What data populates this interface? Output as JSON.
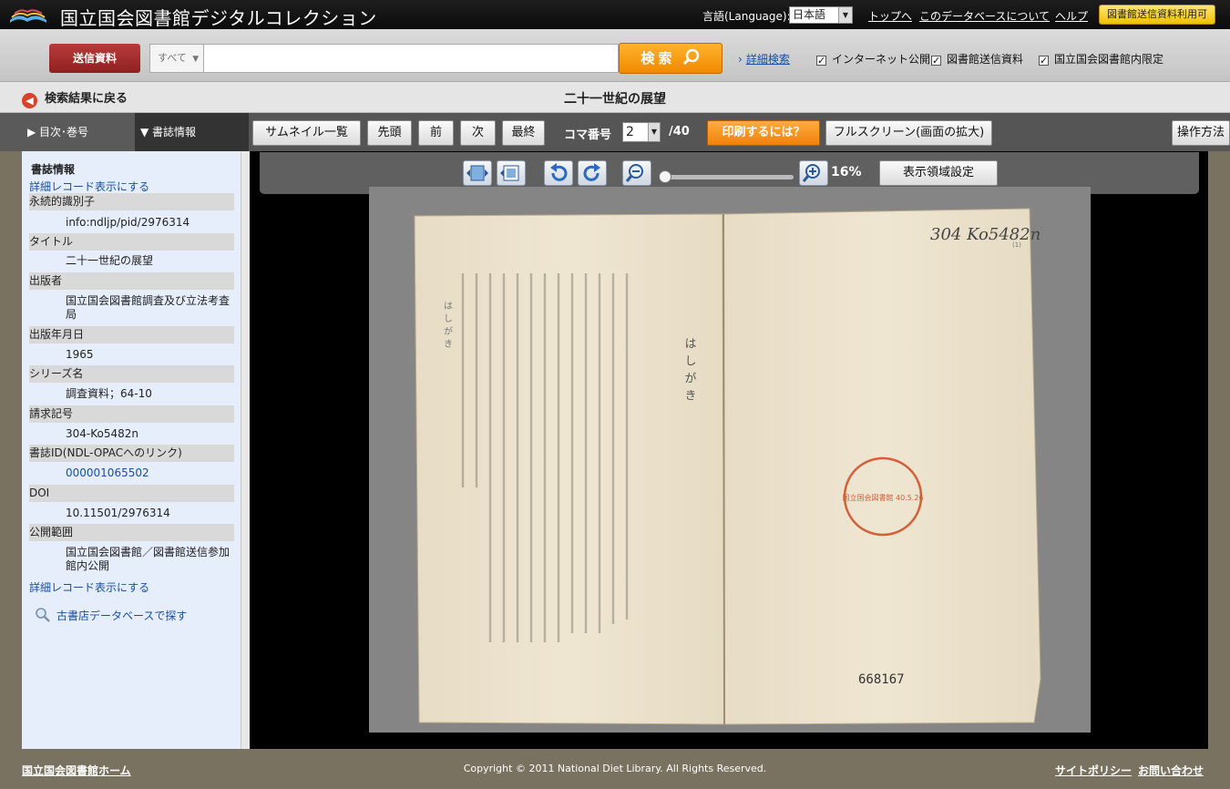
{
  "header": {
    "site_title": "国立国会図書館デジタルコレクション",
    "language_label": "言語(Language):",
    "language_value": "日本語",
    "links": [
      "トップへ",
      "このデータベースについて",
      "ヘルプ"
    ],
    "transmission_button": "図書館送信資料利用可"
  },
  "search": {
    "type_button": "送信資料",
    "scope": "すべて",
    "query": "",
    "search_button": "検索",
    "advanced_link": "詳細検索",
    "filters": [
      {
        "label": "インターネット公開",
        "checked": true
      },
      {
        "label": "図書館送信資料",
        "checked": true
      },
      {
        "label": "国立国会図書館内限定",
        "checked": true
      }
    ]
  },
  "titlebar": {
    "back_label": "検索結果に戻る",
    "title": "二十一世紀の展望"
  },
  "toolbar": {
    "tab_toc": "▶ 目次･巻号",
    "tab_biblio": "▼ 書誌情報",
    "thumbnails": "サムネイル一覧",
    "first": "先頭",
    "prev": "前",
    "next": "次",
    "last": "最終",
    "frame_label": "コマ番号",
    "frame_value": "2",
    "frame_total": "/40",
    "print": "印刷するには？",
    "fullscreen": "フルスクリーン(画面の拡大)",
    "howto": "操作方法"
  },
  "viewer": {
    "zoom_percent": "16%",
    "zoom_fraction": 0.02,
    "display_area_button": "表示領域設定"
  },
  "sidebar": {
    "heading": "書誌情報",
    "detail_link_top": "詳細レコード表示にする",
    "fields": [
      {
        "label": "永続的識別子",
        "value": "info:ndljp/pid/2976314",
        "link": false
      },
      {
        "label": "タイトル",
        "value": "二十一世紀の展望",
        "link": false
      },
      {
        "label": "出版者",
        "value": "国立国会図書館調査及び立法考査局",
        "link": false
      },
      {
        "label": "出版年月日",
        "value": "1965",
        "link": false
      },
      {
        "label": "シリーズ名",
        "value": "調査資料；64-10",
        "link": false
      },
      {
        "label": "請求記号",
        "value": "304-Ko5482n",
        "link": false
      },
      {
        "label": "書誌ID(NDL-OPACへのリンク)",
        "value": "000001065502",
        "link": true
      },
      {
        "label": "DOI",
        "value": "10.11501/2976314",
        "link": false
      },
      {
        "label": "公開範囲",
        "value": "国立国会図書館／図書館送信参加館内公開",
        "link": false
      }
    ],
    "detail_link_bottom": "詳細レコード表示にする",
    "used_books_search": "古書店データベースで探す"
  },
  "page_scan": {
    "heading": "はしがき",
    "handwritten_call_no": "304 Ko5482n",
    "stamp_text": "国立国会図書館 40.5.26",
    "accession_number": "668167",
    "corner_number": "(1)"
  },
  "footer": {
    "home_link": "国立国会図書館ホーム",
    "copyright": "Copyright © 2011 National Diet Library. All Rights Reserved.",
    "site_policy": "サイトポリシー",
    "contact": "お問い合わせ"
  }
}
